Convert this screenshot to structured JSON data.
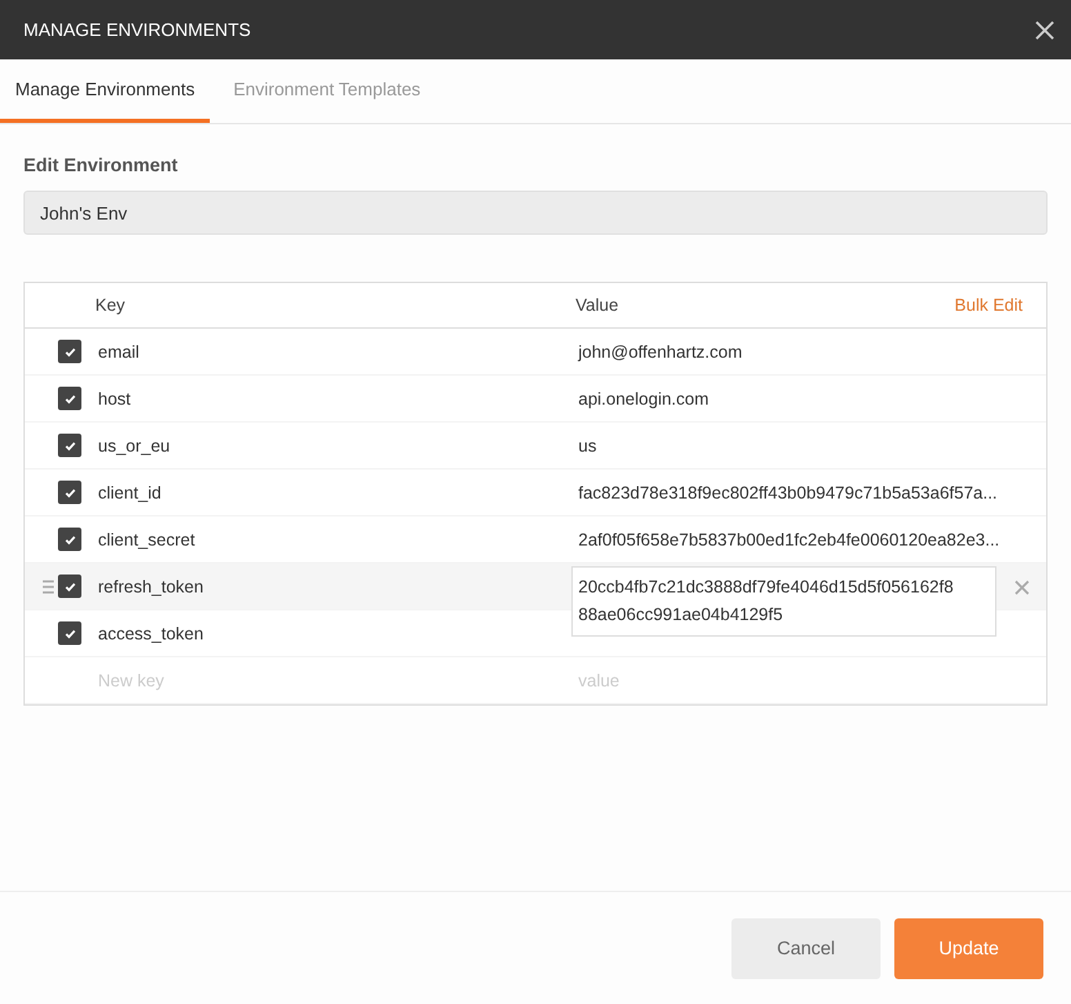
{
  "window": {
    "title": "MANAGE ENVIRONMENTS"
  },
  "tabs": [
    {
      "label": "Manage Environments",
      "selected": true
    },
    {
      "label": "Environment Templates",
      "selected": false
    }
  ],
  "section_title": "Edit Environment",
  "environment_name": "John's Env",
  "table": {
    "columns": [
      "Key",
      "Value"
    ],
    "bulk_edit": "Bulk Edit",
    "rows": [
      {
        "checked": true,
        "key": "email",
        "value": "john@offenhartz.com",
        "hovered": false,
        "editing": false
      },
      {
        "checked": true,
        "key": "host",
        "value": "api.onelogin.com",
        "hovered": false,
        "editing": false
      },
      {
        "checked": true,
        "key": "us_or_eu",
        "value": "us",
        "hovered": false,
        "editing": false
      },
      {
        "checked": true,
        "key": "client_id",
        "value": "fac823d78e318f9ec802ff43b0b9479c71b5a53a6f57a...",
        "hovered": false,
        "editing": false
      },
      {
        "checked": true,
        "key": "client_secret",
        "value": "2af0f05f658e7b5837b00ed1fc2eb4fe0060120ea82e3...",
        "hovered": false,
        "editing": false
      },
      {
        "checked": true,
        "key": "refresh_token",
        "value_lines": [
          "20ccb4fb7c21dc3888df79fe4046d15d5f056162f8",
          "88ae06cc991ae04b4129f5"
        ],
        "hovered": true,
        "editing": true
      },
      {
        "checked": true,
        "key": "access_token",
        "hovered": false,
        "editing": false
      }
    ],
    "new_row": {
      "key_placeholder": "New key",
      "value_placeholder": "value"
    }
  },
  "buttons": {
    "cancel": "Cancel",
    "update": "Update"
  }
}
